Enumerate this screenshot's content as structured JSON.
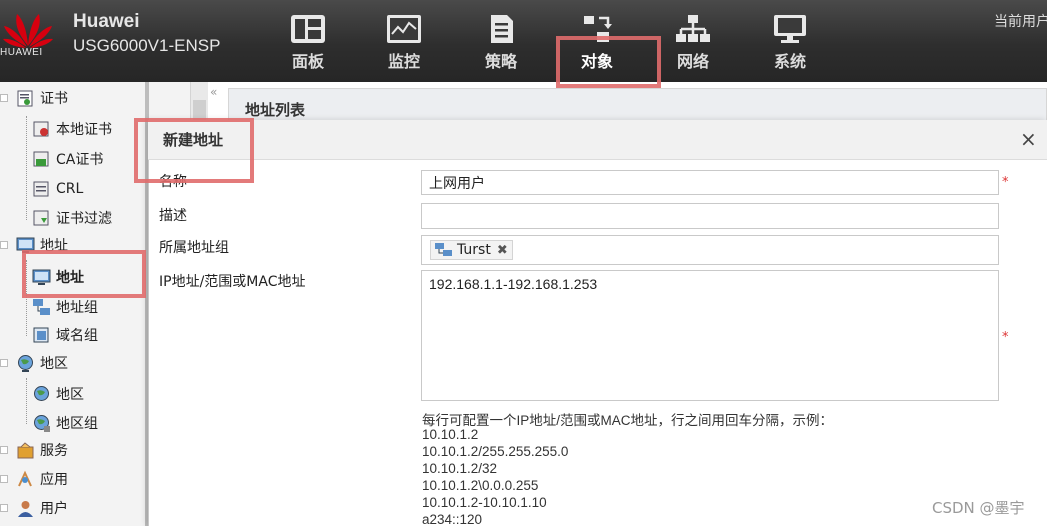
{
  "header": {
    "brand": "Huawei",
    "model": "USG6000V1-ENSP",
    "logo_text": "HUAWEI",
    "user_label": "当前用户",
    "nav": [
      {
        "label": "面板",
        "icon": "dashboard-icon"
      },
      {
        "label": "监控",
        "icon": "monitor-icon"
      },
      {
        "label": "策略",
        "icon": "policy-icon"
      },
      {
        "label": "对象",
        "icon": "object-icon",
        "active": true
      },
      {
        "label": "网络",
        "icon": "network-icon"
      },
      {
        "label": "系统",
        "icon": "system-icon"
      }
    ]
  },
  "sidebar": {
    "collapse_glyph": "«",
    "items": [
      {
        "label": "证书",
        "level": 0,
        "icon": "certificate-icon"
      },
      {
        "label": "本地证书",
        "level": 1,
        "icon": "local-certificate-icon"
      },
      {
        "label": "CA证书",
        "level": 1,
        "icon": "ca-certificate-icon"
      },
      {
        "label": "CRL",
        "level": 1,
        "icon": "crl-icon"
      },
      {
        "label": "证书过滤",
        "level": 1,
        "icon": "certificate-filter-icon"
      },
      {
        "label": "地址",
        "level": 0,
        "icon": "address-icon"
      },
      {
        "label": "地址",
        "level": 1,
        "icon": "address-item-icon",
        "selected": true
      },
      {
        "label": "地址组",
        "level": 1,
        "icon": "address-group-icon"
      },
      {
        "label": "域名组",
        "level": 1,
        "icon": "domain-group-icon"
      },
      {
        "label": "地区",
        "level": 0,
        "icon": "region-icon"
      },
      {
        "label": "地区",
        "level": 1,
        "icon": "region-item-icon"
      },
      {
        "label": "地区组",
        "level": 1,
        "icon": "region-group-icon"
      },
      {
        "label": "服务",
        "level": 0,
        "icon": "service-icon"
      },
      {
        "label": "应用",
        "level": 0,
        "icon": "application-icon"
      },
      {
        "label": "用户",
        "level": 0,
        "icon": "user-icon"
      }
    ]
  },
  "list_panel": {
    "title": "地址列表"
  },
  "dialog": {
    "title": "新建地址",
    "close_glyph": "×",
    "fields": {
      "name_label": "名称",
      "name_value": "上网用户",
      "desc_label": "描述",
      "desc_value": "",
      "group_label": "所属地址组",
      "group_chip": "Turst",
      "chip_remove": "✖",
      "ip_label": "IP地址/范围或MAC地址",
      "ip_value": "192.168.1.1-192.168.1.253",
      "required_mark": "*"
    },
    "hint": {
      "intro": "每行可配置一个IP地址/范围或MAC地址，行之间用回车分隔，示例：",
      "examples": [
        "10.10.1.2",
        "10.10.1.2/255.255.255.0",
        "10.10.1.2/32",
        "10.10.1.2\\0.0.0.255",
        "10.10.1.2-10.10.1.10",
        "a234::120"
      ]
    }
  },
  "watermark": "CSDN @墨宇",
  "colors": {
    "highlight": "#e06c6c",
    "topbar": "#333333",
    "required": "#dd3333"
  }
}
